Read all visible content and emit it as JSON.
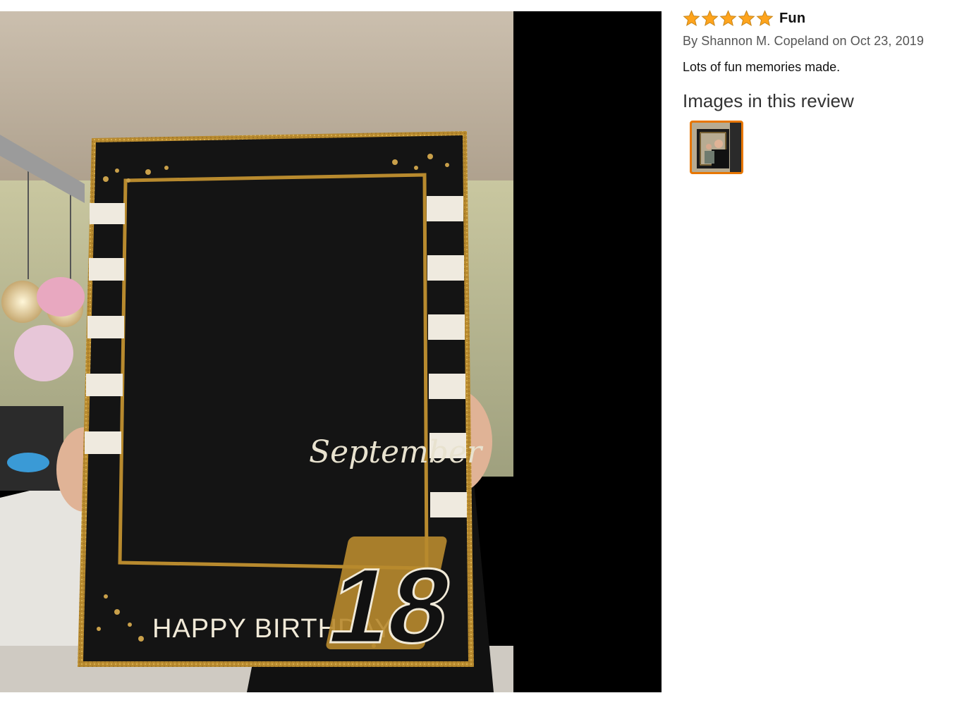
{
  "photo": {
    "frame_text": "HAPPY BIRTHDAY",
    "frame_number": "18",
    "shirt_text": "September"
  },
  "review": {
    "rating": 5,
    "rating_max": 5,
    "star_color": "#ffa41c",
    "title": "Fun",
    "byline": "By Shannon M. Copeland on Oct 23, 2019",
    "body": "Lots of fun memories made.",
    "images_heading": "Images in this review",
    "thumbnail_border_color": "#e77600"
  }
}
